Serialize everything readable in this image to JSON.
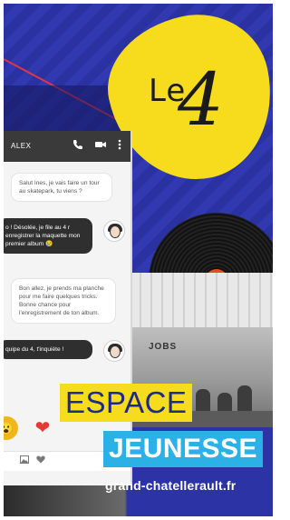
{
  "logo": {
    "le": "Le",
    "number": "4"
  },
  "phone": {
    "contact": "ALEX",
    "header_icons": {
      "call": "phone-icon",
      "video": "video-icon",
      "menu": "more-vertical-icon"
    },
    "messages": [
      {
        "direction": "in",
        "text": "Salut Ines, je vais faire un tour au skatepark, tu viens ?"
      },
      {
        "direction": "out",
        "text": "o ! Désolée, je file au 4 r enregistrer la maquette mon premier album 😢"
      },
      {
        "direction": "in",
        "text": "Bon allez, je prends ma planche pour me faire quelques tricks. Bonne chance pour l'enregistrement de ton album."
      },
      {
        "direction": "out",
        "text": "quipe du 4, t'inquiète !"
      }
    ],
    "reactions": [
      "😮",
      "❤"
    ],
    "input_icons": [
      "image-icon",
      "heart-icon"
    ]
  },
  "photo": {
    "sign": "JOBS"
  },
  "titles": {
    "espace": "ESPACE",
    "jeunesse": "JEUNESSE",
    "url": "grand-chatellerault.fr"
  },
  "colors": {
    "blue": "#2b33a5",
    "yellow": "#f6dc1d",
    "cyan": "#2cb1e6",
    "red": "#e84a28"
  }
}
